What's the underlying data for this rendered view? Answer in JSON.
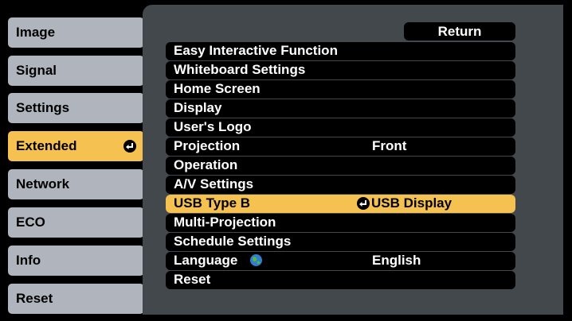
{
  "sidebar": {
    "items": [
      {
        "label": "Image"
      },
      {
        "label": "Signal"
      },
      {
        "label": "Settings"
      },
      {
        "label": "Extended"
      },
      {
        "label": "Network"
      },
      {
        "label": "ECO"
      },
      {
        "label": "Info"
      },
      {
        "label": "Reset"
      }
    ],
    "active_index": 3
  },
  "panel": {
    "return_label": "Return",
    "rows": [
      {
        "label": "Easy Interactive Function",
        "value": ""
      },
      {
        "label": "Whiteboard Settings",
        "value": ""
      },
      {
        "label": "Home Screen",
        "value": ""
      },
      {
        "label": "Display",
        "value": ""
      },
      {
        "label": "User's Logo",
        "value": ""
      },
      {
        "label": "Projection",
        "value": "Front"
      },
      {
        "label": "Operation",
        "value": ""
      },
      {
        "label": "A/V Settings",
        "value": ""
      },
      {
        "label": "USB Type B",
        "value": "USB Display"
      },
      {
        "label": "Multi-Projection",
        "value": ""
      },
      {
        "label": "Schedule Settings",
        "value": ""
      },
      {
        "label": "Language",
        "value": "English"
      },
      {
        "label": "Reset",
        "value": ""
      }
    ],
    "selected_index": 8
  },
  "icons": {
    "enter": "enter-icon",
    "language": "globe-icon"
  },
  "colors": {
    "accent": "#f5c150",
    "sidebar_inactive": "#b0b5bd",
    "panel_bg": "#43484d",
    "row_bg": "#000000"
  }
}
